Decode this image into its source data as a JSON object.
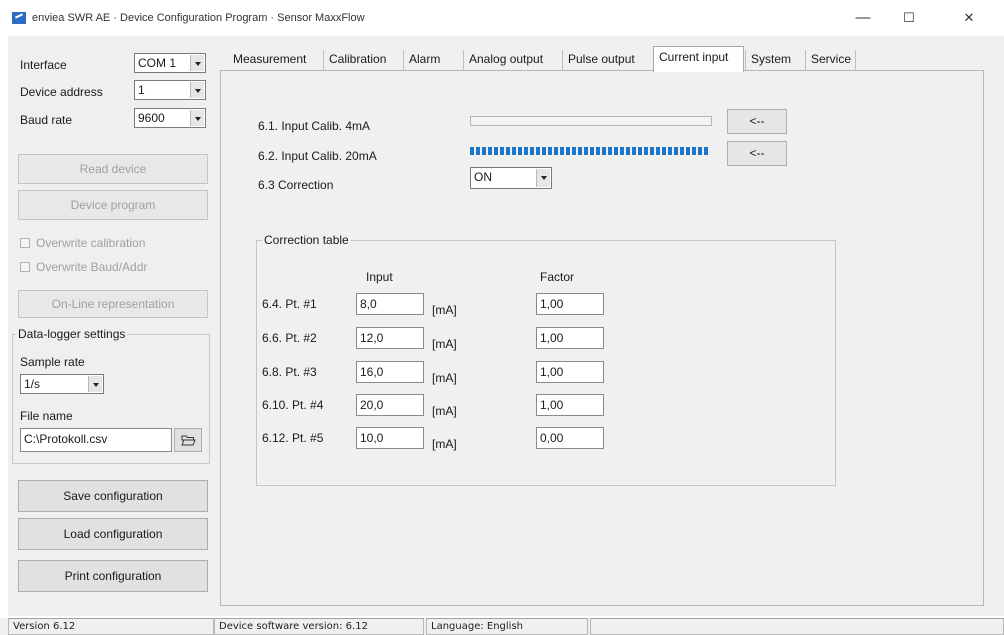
{
  "window": {
    "title": "enviea SWR AE · Device Configuration Program · Sensor MaxxFlow",
    "minimize": "—",
    "maximize": "☐",
    "close": "✕"
  },
  "left": {
    "interface_label": "Interface",
    "interface_value": "COM 1",
    "address_label": "Device address",
    "address_value": "1",
    "baud_label": "Baud rate",
    "baud_value": "9600",
    "read_device": "Read device",
    "device_program": "Device program",
    "overwrite_calibration": "Overwrite calibration",
    "overwrite_baud": "Overwrite Baud/Addr",
    "online": "On-Line representation",
    "datalogger_title": "Data-logger settings",
    "sample_rate_label": "Sample rate",
    "sample_rate_value": "1/s",
    "filename_label": "File name",
    "filename_value": "C:\\Protokoll.csv",
    "save_config": "Save configuration",
    "load_config": "Load configuration",
    "print_config": "Print configuration"
  },
  "tabs": [
    "Measurement",
    "Calibration",
    "Alarm",
    "Analog output",
    "Pulse output",
    "Current input",
    "System",
    "Service"
  ],
  "current_input": {
    "calib_4ma_label": "6.1. Input Calib. 4mA",
    "calib_20ma_label": "6.2. Input Calib. 20mA",
    "calib_4ma_progress": 0,
    "calib_20ma_progress": 1.0,
    "arrow_label": "<--",
    "correction_label": "6.3 Correction",
    "correction_value": "ON",
    "table_title": "Correction table",
    "input_header": "Input",
    "factor_header": "Factor",
    "unit": "[mA]",
    "rows": [
      {
        "label": "6.4. Pt. #1",
        "input": "8,0",
        "factor": "1,00"
      },
      {
        "label": "6.6. Pt. #2",
        "input": "12,0",
        "factor": "1,00"
      },
      {
        "label": "6.8. Pt. #3",
        "input": "16,0",
        "factor": "1,00"
      },
      {
        "label": "6.10. Pt. #4",
        "input": "20,0",
        "factor": "1,00"
      },
      {
        "label": "6.12. Pt. #5",
        "input": "10,0",
        "factor": "0,00"
      }
    ]
  },
  "status": {
    "version": "Version 6.12",
    "device_sw": "Device software version: 6.12",
    "language": "Language: English"
  }
}
